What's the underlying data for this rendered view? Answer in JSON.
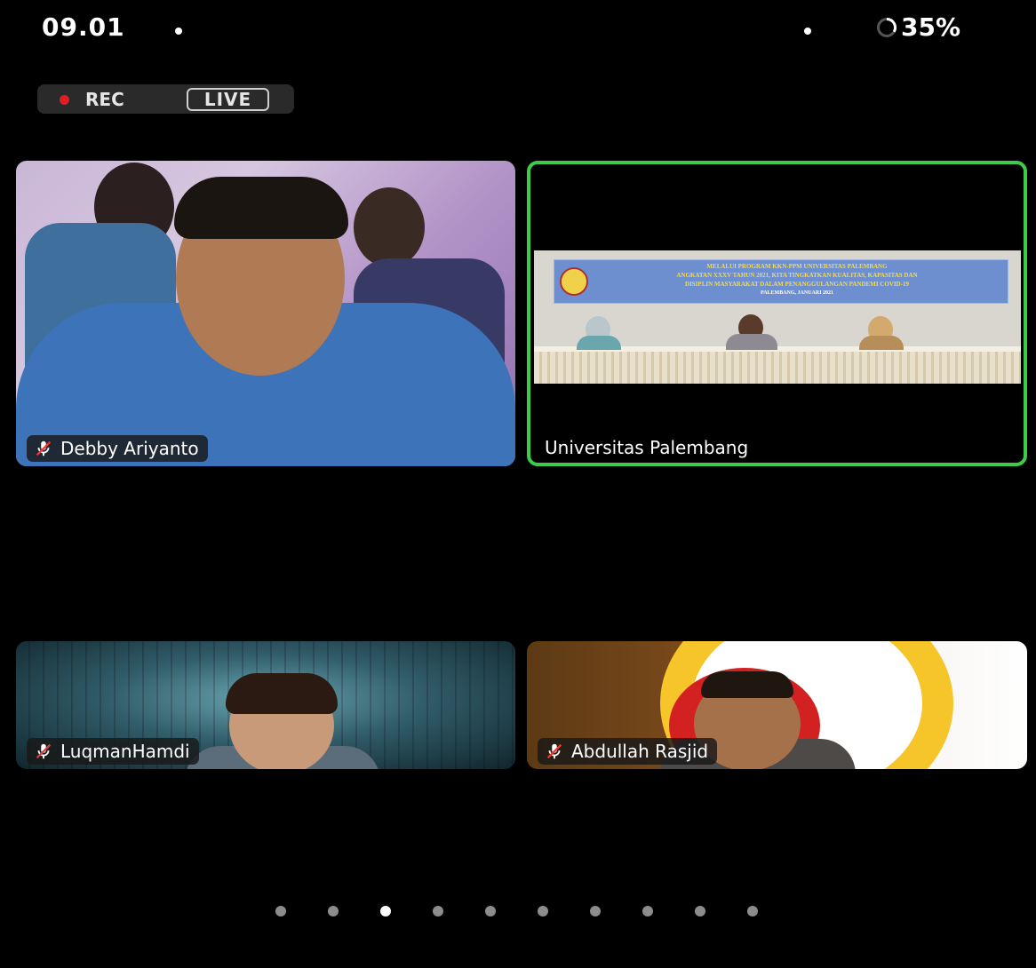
{
  "status_bar": {
    "time": "09.01",
    "battery": "35%"
  },
  "recording": {
    "rec_label": "REC",
    "live_label": "LIVE"
  },
  "participants": [
    {
      "name": "Debby Ariyanto",
      "muted": true
    },
    {
      "name": "Universitas Palembang",
      "muted": false,
      "active_speaker": true
    },
    {
      "name": "LuqmanHamdi",
      "muted": true
    },
    {
      "name": "Abdullah Rasjid",
      "muted": true
    }
  ],
  "banner": {
    "line1": "MELALUI PROGRAM KKN-PPM UNIVERSITAS PALEMBANG",
    "line2": "ANGKATAN XXXV TAHUN 2021, KITA TINGKATKAN KUALITAS, KAPASITAS DAN",
    "line3": "DISIPLIN MASYARAKAT DALAM PENANGGULANGAN PANDEMI COVID-19",
    "line4": "PALEMBANG, JANUARI 2021"
  },
  "pagination": {
    "pages": 10,
    "active_index": 2
  },
  "colors": {
    "active_border": "#3ccc4a",
    "rec_dot": "#e31c23",
    "mute_slash": "#e53935"
  },
  "icons": {
    "mute": "mic-muted-icon",
    "battery": "battery-ring-icon"
  }
}
